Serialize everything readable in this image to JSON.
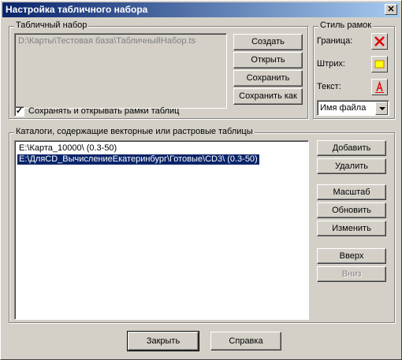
{
  "window": {
    "title": "Настройка табличного набора",
    "close_glyph": "✕"
  },
  "table_set": {
    "group_label": "Табличный набор",
    "path_value": "D:\\Карты\\Тестовая база\\ТабличныйНабор.ts",
    "buttons": {
      "create": "Создать",
      "open": "Открыть",
      "save": "Сохранить",
      "save_as": "Сохранить как"
    },
    "checkbox_label": "Сохранять и открывать рамки таблиц",
    "checkbox_checked": true,
    "check_glyph": "✓"
  },
  "frame_style": {
    "group_label": "Стиль рамок",
    "border_label": "Граница:",
    "stroke_label": "Штрих:",
    "text_label": "Текст:",
    "select_value": "Имя файла",
    "icons": {
      "border": "red-x-icon",
      "stroke": "yellow-rectangle-icon",
      "text": "red-letter-a-icon"
    },
    "colors": {
      "border_x": "#e00000",
      "stroke_fill": "#ffff00",
      "stroke_outline": "#c08000",
      "text_a": "#e00000"
    }
  },
  "catalogs": {
    "group_label": "Каталоги, содержащие векторные или растровые таблицы",
    "items": [
      "E:\\Карта_10000\\  (0.3-50)",
      "E:\\ДляCD_ВычислениеЕкатеринбург\\Готовые\\CD3\\  (0.3-50)"
    ],
    "selected_index": 1,
    "buttons": {
      "add": "Добавить",
      "delete": "Удалить",
      "scale": "Масштаб",
      "refresh": "Обновить",
      "edit": "Изменить",
      "up": "Вверх",
      "down": "Вниз"
    }
  },
  "footer": {
    "close": "Закрыть",
    "help": "Справка"
  }
}
